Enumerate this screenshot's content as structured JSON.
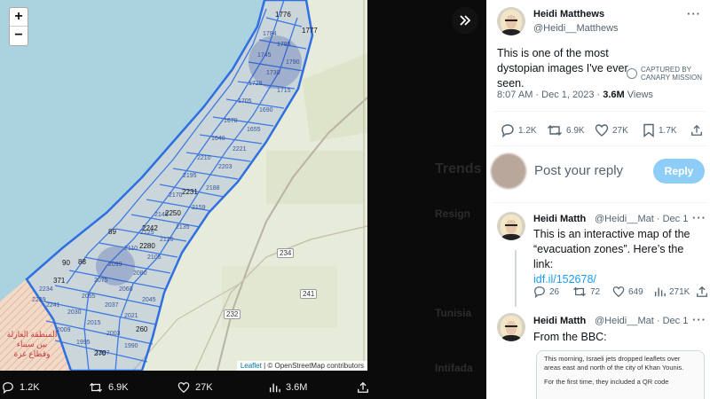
{
  "map": {
    "zoom_in": "+",
    "zoom_out": "−",
    "attribution_leaflet": "Leaflet",
    "attribution_rest": " | © OpenStreetMap contributors",
    "zone_numbers": [
      "1776",
      "1777",
      "2231",
      "2250",
      "2280",
      "2242",
      "260",
      "270",
      "88",
      "90",
      "89",
      "371"
    ],
    "road_numbers": [
      "234",
      "241",
      "232"
    ],
    "arabic_label": "المنطقة العازلة بين سيناء وقطاع غزة"
  },
  "media_actions": {
    "replies": "1.2K",
    "reposts": "6.9K",
    "likes": "27K",
    "views": "3.6M"
  },
  "background_timeline": {
    "trends_heading": "Trends",
    "items": [
      "Resign",
      "Tunisia",
      "Intifada"
    ]
  },
  "main_tweet": {
    "author_name": "Heidi Matthews",
    "author_handle": "@Heidi__Matthews",
    "more": "···",
    "text": "This is one of the most dystopian images I've ever seen.",
    "captured_label_1": "CAPTURED BY",
    "captured_label_2": "CANARY MISSION",
    "time": "8:07 AM · Dec 1, 2023 · ",
    "views_count": "3.6M",
    "views_label": " Views",
    "replies": "1.2K",
    "reposts": "6.9K",
    "likes": "27K",
    "bookmarks": "1.7K"
  },
  "composer": {
    "placeholder": "Post your reply",
    "button": "Reply"
  },
  "reply1": {
    "author_name": "Heidi Matth",
    "author_handle": "@Heidi__Mat · Dec 1",
    "more": "···",
    "text": "This is an interactive map of the “evacuation zones”. Here’s the link:",
    "link": "idf.il/152678/",
    "replies": "26",
    "reposts": "72",
    "likes": "649",
    "views": "271K"
  },
  "reply2": {
    "author_name": "Heidi Matth",
    "author_handle": "@Heidi__Mat · Dec 1",
    "more": "···",
    "text": "From the BBC:",
    "card_p1": "This morning, Israeli jets dropped leaflets over areas east and north of the city of Khan Younis.",
    "card_p2": "For the first time, they included a QR code"
  },
  "colors": {
    "accent": "#1d9bf0",
    "zone_stroke": "#2f6fe0",
    "sea": "#aad3df",
    "land": "#e9ecdd"
  }
}
